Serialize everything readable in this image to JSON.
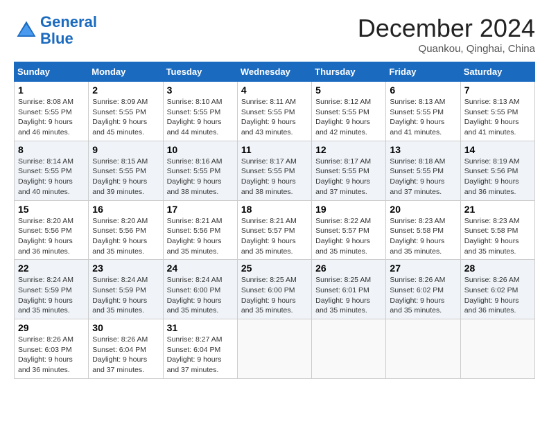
{
  "header": {
    "logo_line1": "General",
    "logo_line2": "Blue",
    "month_year": "December 2024",
    "location": "Quankou, Qinghai, China"
  },
  "weekdays": [
    "Sunday",
    "Monday",
    "Tuesday",
    "Wednesday",
    "Thursday",
    "Friday",
    "Saturday"
  ],
  "weeks": [
    [
      {
        "day": "1",
        "info": "Sunrise: 8:08 AM\nSunset: 5:55 PM\nDaylight: 9 hours and 46 minutes."
      },
      {
        "day": "2",
        "info": "Sunrise: 8:09 AM\nSunset: 5:55 PM\nDaylight: 9 hours and 45 minutes."
      },
      {
        "day": "3",
        "info": "Sunrise: 8:10 AM\nSunset: 5:55 PM\nDaylight: 9 hours and 44 minutes."
      },
      {
        "day": "4",
        "info": "Sunrise: 8:11 AM\nSunset: 5:55 PM\nDaylight: 9 hours and 43 minutes."
      },
      {
        "day": "5",
        "info": "Sunrise: 8:12 AM\nSunset: 5:55 PM\nDaylight: 9 hours and 42 minutes."
      },
      {
        "day": "6",
        "info": "Sunrise: 8:13 AM\nSunset: 5:55 PM\nDaylight: 9 hours and 41 minutes."
      },
      {
        "day": "7",
        "info": "Sunrise: 8:13 AM\nSunset: 5:55 PM\nDaylight: 9 hours and 41 minutes."
      }
    ],
    [
      {
        "day": "8",
        "info": "Sunrise: 8:14 AM\nSunset: 5:55 PM\nDaylight: 9 hours and 40 minutes."
      },
      {
        "day": "9",
        "info": "Sunrise: 8:15 AM\nSunset: 5:55 PM\nDaylight: 9 hours and 39 minutes."
      },
      {
        "day": "10",
        "info": "Sunrise: 8:16 AM\nSunset: 5:55 PM\nDaylight: 9 hours and 38 minutes."
      },
      {
        "day": "11",
        "info": "Sunrise: 8:17 AM\nSunset: 5:55 PM\nDaylight: 9 hours and 38 minutes."
      },
      {
        "day": "12",
        "info": "Sunrise: 8:17 AM\nSunset: 5:55 PM\nDaylight: 9 hours and 37 minutes."
      },
      {
        "day": "13",
        "info": "Sunrise: 8:18 AM\nSunset: 5:55 PM\nDaylight: 9 hours and 37 minutes."
      },
      {
        "day": "14",
        "info": "Sunrise: 8:19 AM\nSunset: 5:56 PM\nDaylight: 9 hours and 36 minutes."
      }
    ],
    [
      {
        "day": "15",
        "info": "Sunrise: 8:20 AM\nSunset: 5:56 PM\nDaylight: 9 hours and 36 minutes."
      },
      {
        "day": "16",
        "info": "Sunrise: 8:20 AM\nSunset: 5:56 PM\nDaylight: 9 hours and 35 minutes."
      },
      {
        "day": "17",
        "info": "Sunrise: 8:21 AM\nSunset: 5:56 PM\nDaylight: 9 hours and 35 minutes."
      },
      {
        "day": "18",
        "info": "Sunrise: 8:21 AM\nSunset: 5:57 PM\nDaylight: 9 hours and 35 minutes."
      },
      {
        "day": "19",
        "info": "Sunrise: 8:22 AM\nSunset: 5:57 PM\nDaylight: 9 hours and 35 minutes."
      },
      {
        "day": "20",
        "info": "Sunrise: 8:23 AM\nSunset: 5:58 PM\nDaylight: 9 hours and 35 minutes."
      },
      {
        "day": "21",
        "info": "Sunrise: 8:23 AM\nSunset: 5:58 PM\nDaylight: 9 hours and 35 minutes."
      }
    ],
    [
      {
        "day": "22",
        "info": "Sunrise: 8:24 AM\nSunset: 5:59 PM\nDaylight: 9 hours and 35 minutes."
      },
      {
        "day": "23",
        "info": "Sunrise: 8:24 AM\nSunset: 5:59 PM\nDaylight: 9 hours and 35 minutes."
      },
      {
        "day": "24",
        "info": "Sunrise: 8:24 AM\nSunset: 6:00 PM\nDaylight: 9 hours and 35 minutes."
      },
      {
        "day": "25",
        "info": "Sunrise: 8:25 AM\nSunset: 6:00 PM\nDaylight: 9 hours and 35 minutes."
      },
      {
        "day": "26",
        "info": "Sunrise: 8:25 AM\nSunset: 6:01 PM\nDaylight: 9 hours and 35 minutes."
      },
      {
        "day": "27",
        "info": "Sunrise: 8:26 AM\nSunset: 6:02 PM\nDaylight: 9 hours and 35 minutes."
      },
      {
        "day": "28",
        "info": "Sunrise: 8:26 AM\nSunset: 6:02 PM\nDaylight: 9 hours and 36 minutes."
      }
    ],
    [
      {
        "day": "29",
        "info": "Sunrise: 8:26 AM\nSunset: 6:03 PM\nDaylight: 9 hours and 36 minutes."
      },
      {
        "day": "30",
        "info": "Sunrise: 8:26 AM\nSunset: 6:04 PM\nDaylight: 9 hours and 37 minutes."
      },
      {
        "day": "31",
        "info": "Sunrise: 8:27 AM\nSunset: 6:04 PM\nDaylight: 9 hours and 37 minutes."
      },
      {
        "day": "",
        "info": ""
      },
      {
        "day": "",
        "info": ""
      },
      {
        "day": "",
        "info": ""
      },
      {
        "day": "",
        "info": ""
      }
    ]
  ]
}
